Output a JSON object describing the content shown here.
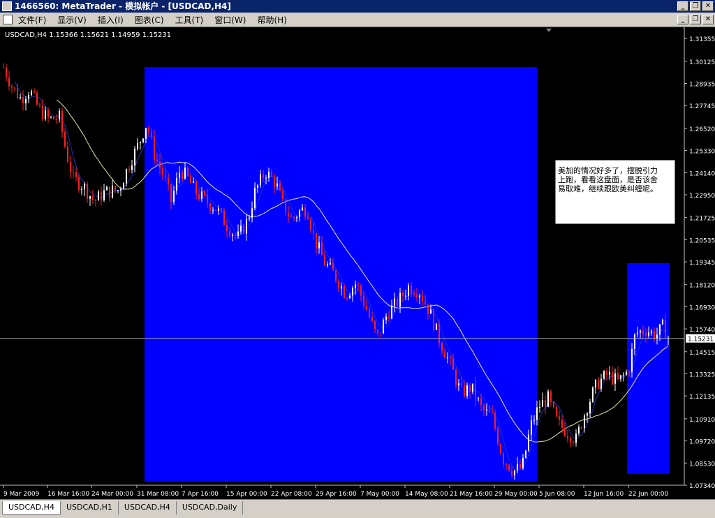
{
  "window": {
    "title": "1466560: MetaTrader - 模拟帐户 - [USDCAD,H4]",
    "buttons": [
      "_",
      "❐",
      "✕"
    ]
  },
  "menu": {
    "items": [
      "文件(F)",
      "显示(V)",
      "插入(I)",
      "图表(C)",
      "工具(T)",
      "窗口(W)",
      "帮助(H)"
    ]
  },
  "chart": {
    "header": "USDCAD,H4  1.15366 1.15621 1.14959 1.15231",
    "price_labels": [
      "1.31355",
      "1.30125",
      "1.28935",
      "1.27745",
      "1.26520",
      "1.25330",
      "1.24140",
      "1.22950",
      "1.21725",
      "1.20535",
      "1.19345",
      "1.18120",
      "1.16930",
      "1.15740",
      "1.14515",
      "1.13325",
      "1.12135",
      "1.10910",
      "1.09720",
      "1.08530",
      "1.07340"
    ],
    "current_price": "1.15231",
    "date_labels": [
      "9 Mar 2009",
      "16 Mar 16:00",
      "24 Mar 00:00",
      "31 Mar 08:00",
      "7 Apr 16:00",
      "15 Apr 00:00",
      "22 Apr 08:00",
      "29 Apr 16:00",
      "7 May 00:00",
      "14 May 08:00",
      "21 May 16:00",
      "29 May 00:00",
      "5 Jun 08:00",
      "12 Jun 16:00",
      "22 Jun 00:00"
    ],
    "note": [
      "美加的情况好多了，摆脱引力",
      "上跑，看看这盘面，是否该舍",
      "易取难，继续跟欧美纠缠呢。"
    ],
    "colors": {
      "background": "#000000",
      "highlight": "#0000ff",
      "bull_candle": "#ffffff",
      "bear_candle": "#ff2020",
      "ma_slow": "#e8e8a0",
      "ma_fast": "#2030c0"
    }
  },
  "tabs": [
    {
      "label": "USDCAD,H4",
      "active": true
    },
    {
      "label": "USDCAD,H1",
      "active": false
    },
    {
      "label": "USDCAD,H4",
      "active": false
    },
    {
      "label": "USDCAD,Daily",
      "active": false
    }
  ]
}
